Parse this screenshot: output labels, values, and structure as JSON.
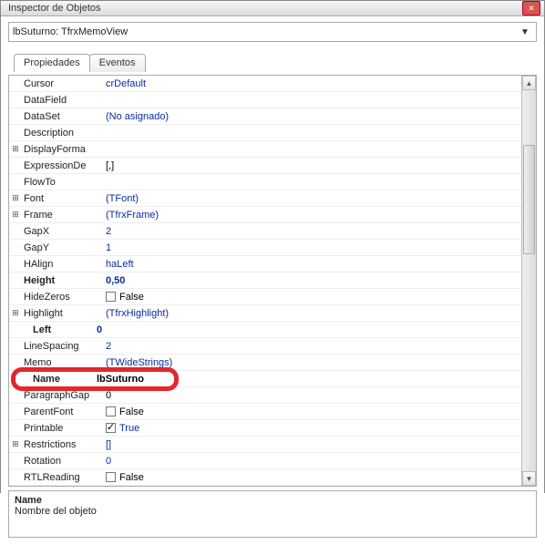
{
  "window": {
    "title": "Inspector de Objetos",
    "close_label": "✕"
  },
  "selector": {
    "text": "lbSuturno: TfrxMemoView"
  },
  "tabs": {
    "properties": "Propiedades",
    "events": "Eventos"
  },
  "rows": [
    {
      "tree": "",
      "name": "Cursor",
      "value": "crDefault",
      "link": true
    },
    {
      "tree": "",
      "name": "DataField",
      "value": ""
    },
    {
      "tree": "",
      "name": "DataSet",
      "value": "(No asignado)",
      "link": true
    },
    {
      "tree": "",
      "name": "Description",
      "value": ""
    },
    {
      "tree": "+",
      "name": "DisplayForma",
      "value": ""
    },
    {
      "tree": "",
      "name": "ExpressionDe",
      "value": "[,]"
    },
    {
      "tree": "",
      "name": "FlowTo",
      "value": ""
    },
    {
      "tree": "+",
      "name": "Font",
      "value": "(TFont)",
      "link": true
    },
    {
      "tree": "+",
      "name": "Frame",
      "value": "(TfrxFrame)",
      "link": true
    },
    {
      "tree": "",
      "name": "GapX",
      "value": "2",
      "link": true
    },
    {
      "tree": "",
      "name": "GapY",
      "value": "1",
      "link": true
    },
    {
      "tree": "",
      "name": "HAlign",
      "value": "haLeft",
      "link": true
    },
    {
      "tree": "",
      "name": "Height",
      "value": "0,50",
      "bold": true,
      "link": true
    },
    {
      "tree": "",
      "name": "HideZeros",
      "value": "False",
      "checkbox": true,
      "checked": false
    },
    {
      "tree": "+",
      "name": "Highlight",
      "value": "(TfrxHighlight)",
      "link": true
    },
    {
      "tree": "",
      "name": "Left",
      "value": "0",
      "bold": true,
      "link": true,
      "indent": true
    },
    {
      "tree": "",
      "name": "LineSpacing",
      "value": "2",
      "link": true
    },
    {
      "tree": "",
      "name": "Memo",
      "value": "(TWideStrings)",
      "link": true
    },
    {
      "tree": "",
      "name": "Name",
      "value": "lbSuturno",
      "bold": true,
      "indent": true
    },
    {
      "tree": "",
      "name": "ParagraphGap",
      "value": "0"
    },
    {
      "tree": "",
      "name": "ParentFont",
      "value": "False",
      "checkbox": true,
      "checked": false
    },
    {
      "tree": "",
      "name": "Printable",
      "value": "True",
      "checkbox": true,
      "checked": true,
      "link": true
    },
    {
      "tree": "+",
      "name": "Restrictions",
      "value": "[]",
      "link": true
    },
    {
      "tree": "",
      "name": "Rotation",
      "value": "0",
      "link": true
    },
    {
      "tree": "",
      "name": "RTLReading",
      "value": "False",
      "checkbox": true,
      "checked": false
    }
  ],
  "description": {
    "title": "Name",
    "text": "Nombre del objeto"
  }
}
